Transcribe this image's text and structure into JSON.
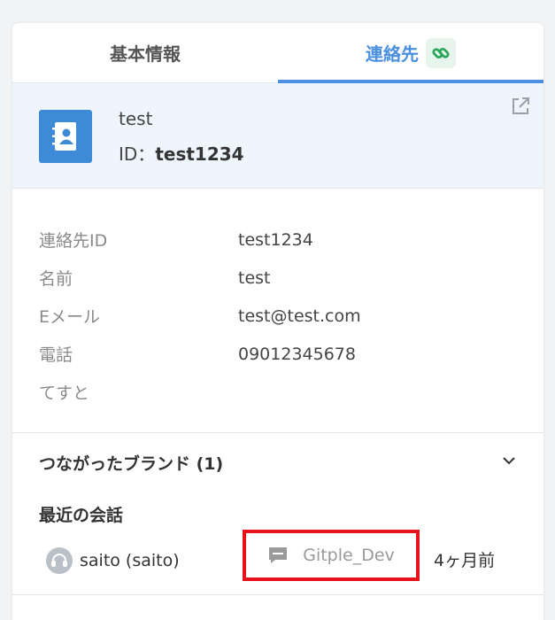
{
  "tabs": [
    {
      "label": "基本情報"
    },
    {
      "label": "連絡先"
    }
  ],
  "contact": {
    "name": "test",
    "id_prefix": "ID：",
    "id_value": "test1234"
  },
  "details": [
    {
      "label": "連絡先ID",
      "value": "test1234"
    },
    {
      "label": "名前",
      "value": "test"
    },
    {
      "label": "Eメール",
      "value": "test@test.com"
    },
    {
      "label": "電話",
      "value": "09012345678"
    },
    {
      "label": "てすと",
      "value": ""
    }
  ],
  "brands": {
    "label": "つながったブランド (1)"
  },
  "recent": {
    "title": "最近の会話",
    "agent": "saito (saito)",
    "channel": "Gitple_Dev",
    "time": "4ヶ月前"
  },
  "colors": {
    "accent": "#4a8fe0",
    "highlight": "#e8101a",
    "contact_icon_bg": "#3d8bd6",
    "link_green": "#2aa55a"
  },
  "icons": [
    "link-icon",
    "contact-book-icon",
    "external-link-icon",
    "chevron-down-icon",
    "headset-icon",
    "chat-icon"
  ]
}
